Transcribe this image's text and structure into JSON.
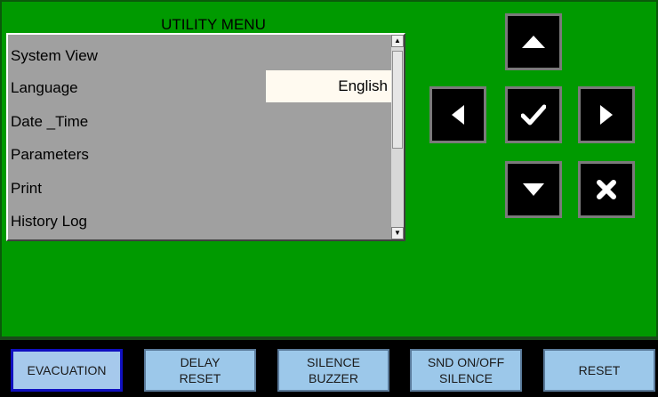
{
  "menu": {
    "title": "UTILITY MENU",
    "items": [
      {
        "label": "System View"
      },
      {
        "label": "Language",
        "value": "English"
      },
      {
        "label": "Date _Time"
      },
      {
        "label": "Parameters"
      },
      {
        "label": "Print"
      },
      {
        "label": "History Log"
      }
    ]
  },
  "nav_pad": {
    "buttons": [
      {
        "name": "up",
        "icon": "arrow-up-icon"
      },
      {
        "name": "left",
        "icon": "arrow-left-icon"
      },
      {
        "name": "confirm",
        "icon": "check-icon"
      },
      {
        "name": "right",
        "icon": "arrow-right-icon"
      },
      {
        "name": "down",
        "icon": "arrow-down-icon"
      },
      {
        "name": "cancel",
        "icon": "x-icon"
      }
    ]
  },
  "function_bar": {
    "evacuation": {
      "line1": "EVACUATION"
    },
    "delay_reset": {
      "line1": "DELAY",
      "line2": "RESET"
    },
    "silence_buzzer": {
      "line1": "SILENCE",
      "line2": "BUZZER"
    },
    "snd_silence": {
      "line1": "SND ON/OFF",
      "line2": "SILENCE"
    },
    "reset": {
      "line1": "RESET"
    }
  },
  "colors": {
    "background": "#009a00",
    "menu_box": "#a0a0a0",
    "button_face": "#9cc8ea",
    "nav_button": "#000000"
  }
}
